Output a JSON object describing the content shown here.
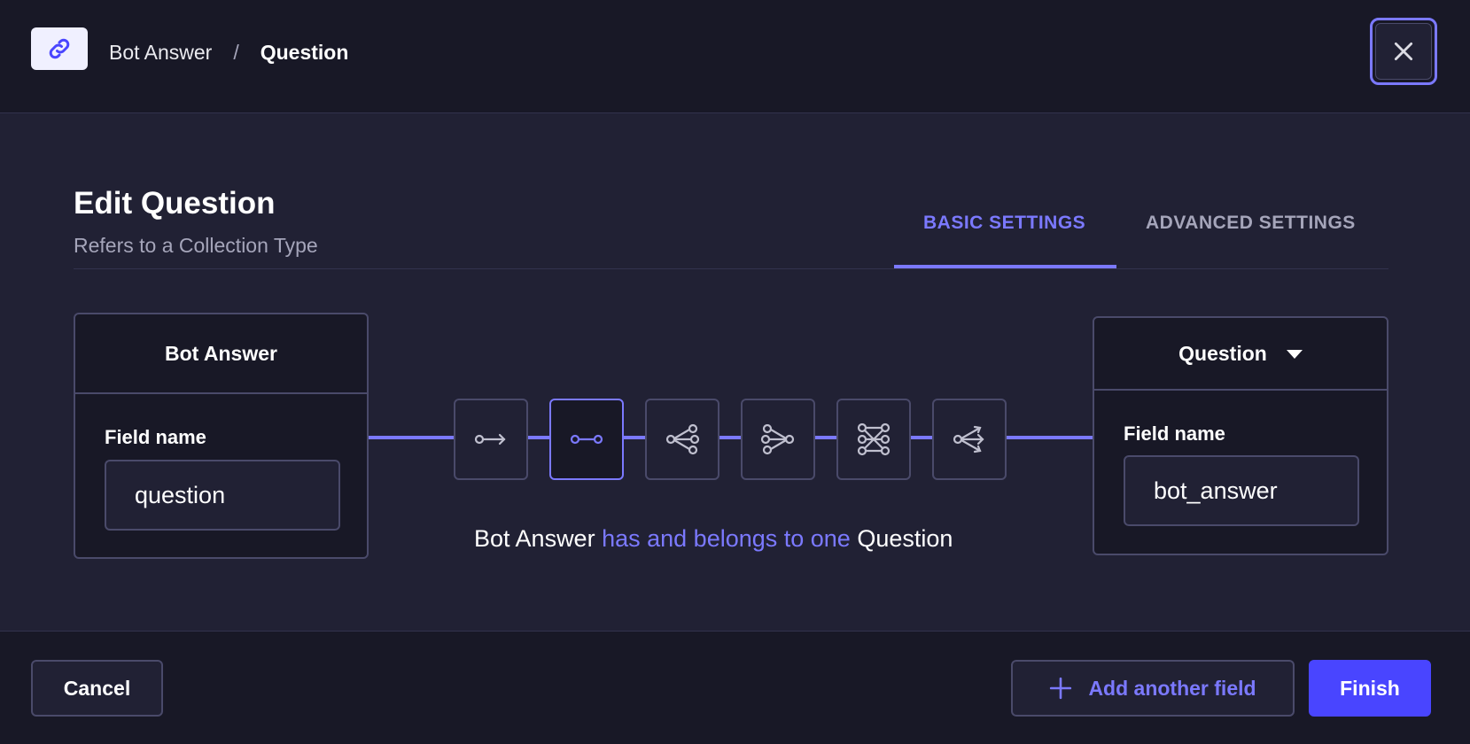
{
  "header": {
    "icon": "link-icon",
    "breadcrumb": [
      "Bot Answer",
      "/",
      "Question"
    ],
    "close_icon": "close-icon"
  },
  "main": {
    "title": "Edit Question",
    "subtitle": "Refers to a Collection Type",
    "tabs": [
      {
        "label": "BASIC SETTINGS",
        "active": true
      },
      {
        "label": "ADVANCED SETTINGS",
        "active": false
      }
    ]
  },
  "relation": {
    "left": {
      "name": "Bot Answer",
      "field_label": "Field name",
      "field_value": "question"
    },
    "right": {
      "name": "Question",
      "field_label": "Field name",
      "field_value": "bot_answer",
      "dropdown_icon": "caret-down-icon"
    },
    "types": [
      {
        "icon": "one-way-icon",
        "active": false
      },
      {
        "icon": "one-to-one-icon",
        "active": true
      },
      {
        "icon": "one-to-many-icon",
        "active": false
      },
      {
        "icon": "many-to-one-icon",
        "active": false
      },
      {
        "icon": "many-to-many-icon",
        "active": false
      },
      {
        "icon": "many-way-icon",
        "active": false
      }
    ],
    "sentence": {
      "start": "Bot Answer",
      "middle": "has and belongs to one",
      "end": "Question"
    }
  },
  "footer": {
    "cancel_label": "Cancel",
    "add_label": "Add another field",
    "add_icon": "plus-icon",
    "finish_label": "Finish"
  },
  "colors": {
    "accent": "#7b79ff",
    "primary_button": "#4945ff",
    "background": "#212134",
    "surface": "#181826",
    "border": "#4a4a6a"
  }
}
